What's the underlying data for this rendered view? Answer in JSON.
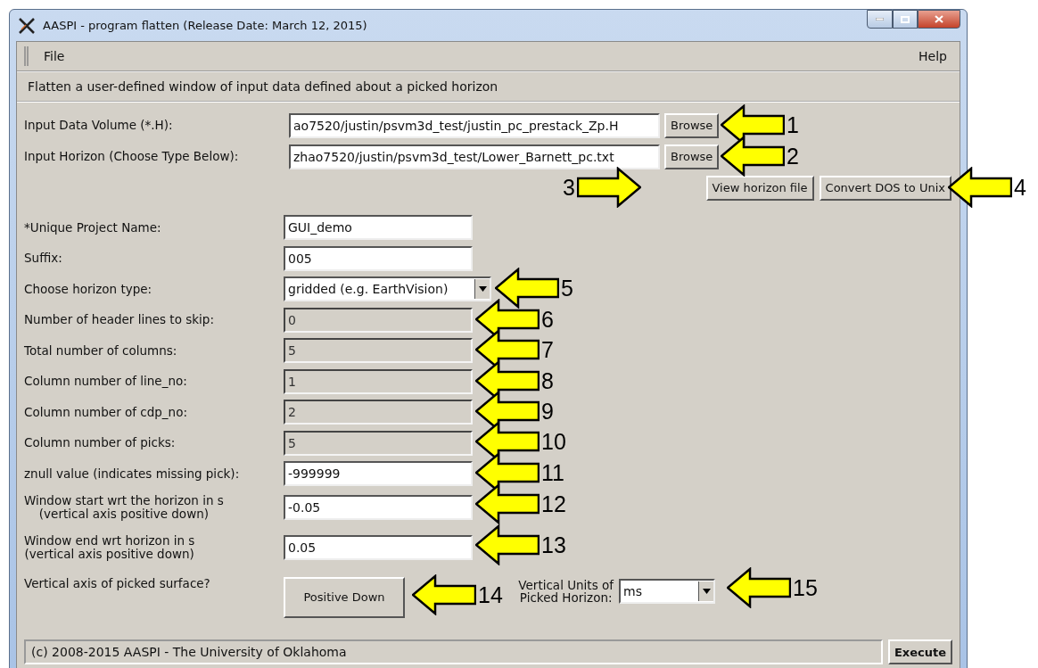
{
  "window": {
    "title": "AASPI - program flatten (Release Date: March 12, 2015)"
  },
  "menu": [
    {
      "label": "File"
    },
    {
      "label": "Help"
    }
  ],
  "description": "Flatten a user-defined window of input data defined about a picked horizon",
  "file_inputs": [
    {
      "label": "Input Data Volume (*.H):",
      "value": "ao7520/justin/psvm3d_test/justin_pc_prestack_Zp.H",
      "button": "Browse"
    },
    {
      "label": "Input Horizon (Choose Type Below):",
      "value": "zhao7520/justin/psvm3d_test/Lower_Barnett_pc.txt",
      "button": "Browse"
    }
  ],
  "action_buttons": [
    "View horizon file",
    "Convert DOS to Unix"
  ],
  "fields": [
    {
      "kind": "text",
      "label": [
        "*Unique Project Name:"
      ],
      "value": "GUI_demo",
      "disabled": false
    },
    {
      "kind": "text",
      "label": [
        "Suffix:"
      ],
      "value": "005",
      "disabled": false
    },
    {
      "kind": "select",
      "label": [
        "Choose horizon type:"
      ],
      "value": "gridded (e.g. EarthVision)"
    },
    {
      "kind": "text",
      "label": [
        "Number of header lines to skip:"
      ],
      "value": "0",
      "disabled": true
    },
    {
      "kind": "text",
      "label": [
        "Total number of columns:"
      ],
      "value": "5",
      "disabled": true
    },
    {
      "kind": "text",
      "label": [
        "Column number of line_no:"
      ],
      "value": "1",
      "disabled": true
    },
    {
      "kind": "text",
      "label": [
        "Column number of cdp_no:"
      ],
      "value": "2",
      "disabled": true
    },
    {
      "kind": "text",
      "label": [
        "Column number of picks:"
      ],
      "value": "5",
      "disabled": true
    },
    {
      "kind": "text",
      "label": [
        "znull value (indicates missing pick):"
      ],
      "value": "-999999",
      "disabled": false
    },
    {
      "kind": "text",
      "label": [
        "Window start wrt the horizon in s",
        "(vertical axis positive down)"
      ],
      "value": "-0.05",
      "disabled": false
    },
    {
      "kind": "text",
      "label": [
        "Window end wrt horizon in s",
        "(vertical axis positive down)"
      ],
      "value": "0.05",
      "disabled": false
    }
  ],
  "vertical_axis": {
    "label": "Vertical axis of picked surface?",
    "button": "Positive Down"
  },
  "vertical_units": {
    "label": [
      "Vertical Units of",
      "Picked Horizon:"
    ],
    "value": "ms"
  },
  "status_bar": {
    "text": "(c) 2008-2015 AASPI - The University of Oklahoma",
    "button": "Execute"
  },
  "annotations": [
    {
      "label": "1",
      "kind": "left"
    },
    {
      "label": "2",
      "kind": "left"
    },
    {
      "label": "3",
      "kind": "right"
    },
    {
      "label": "4",
      "kind": "left"
    },
    {
      "label": "5",
      "kind": "left"
    },
    {
      "label": "6",
      "kind": "left"
    },
    {
      "label": "7",
      "kind": "left"
    },
    {
      "label": "8",
      "kind": "left"
    },
    {
      "label": "9",
      "kind": "left"
    },
    {
      "label": "10",
      "kind": "left"
    },
    {
      "label": "11",
      "kind": "left"
    },
    {
      "label": "12",
      "kind": "left"
    },
    {
      "label": "13",
      "kind": "left"
    },
    {
      "label": "14",
      "kind": "left"
    },
    {
      "label": "15",
      "kind": "left"
    }
  ]
}
